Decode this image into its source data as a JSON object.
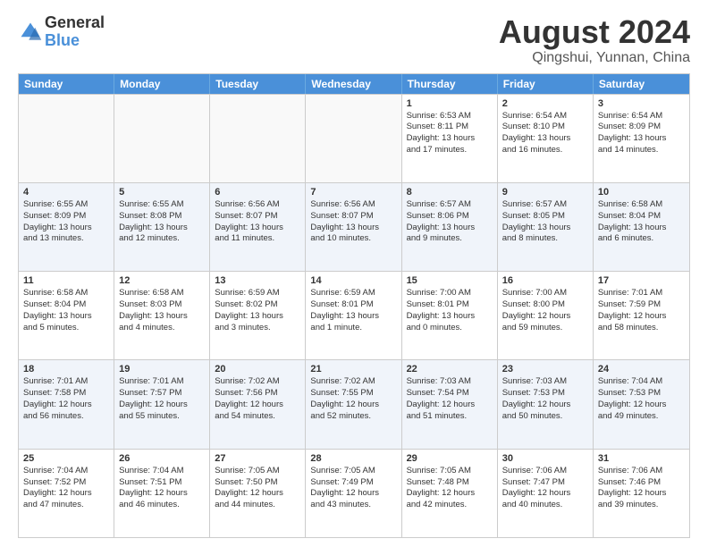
{
  "logo": {
    "general": "General",
    "blue": "Blue"
  },
  "title": "August 2024",
  "location": "Qingshui, Yunnan, China",
  "header_days": [
    "Sunday",
    "Monday",
    "Tuesday",
    "Wednesday",
    "Thursday",
    "Friday",
    "Saturday"
  ],
  "rows": [
    [
      {
        "day": "",
        "lines": [],
        "empty": true
      },
      {
        "day": "",
        "lines": [],
        "empty": true
      },
      {
        "day": "",
        "lines": [],
        "empty": true
      },
      {
        "day": "",
        "lines": [],
        "empty": true
      },
      {
        "day": "1",
        "lines": [
          "Sunrise: 6:53 AM",
          "Sunset: 8:11 PM",
          "Daylight: 13 hours",
          "and 17 minutes."
        ]
      },
      {
        "day": "2",
        "lines": [
          "Sunrise: 6:54 AM",
          "Sunset: 8:10 PM",
          "Daylight: 13 hours",
          "and 16 minutes."
        ]
      },
      {
        "day": "3",
        "lines": [
          "Sunrise: 6:54 AM",
          "Sunset: 8:09 PM",
          "Daylight: 13 hours",
          "and 14 minutes."
        ]
      }
    ],
    [
      {
        "day": "4",
        "lines": [
          "Sunrise: 6:55 AM",
          "Sunset: 8:09 PM",
          "Daylight: 13 hours",
          "and 13 minutes."
        ]
      },
      {
        "day": "5",
        "lines": [
          "Sunrise: 6:55 AM",
          "Sunset: 8:08 PM",
          "Daylight: 13 hours",
          "and 12 minutes."
        ]
      },
      {
        "day": "6",
        "lines": [
          "Sunrise: 6:56 AM",
          "Sunset: 8:07 PM",
          "Daylight: 13 hours",
          "and 11 minutes."
        ]
      },
      {
        "day": "7",
        "lines": [
          "Sunrise: 6:56 AM",
          "Sunset: 8:07 PM",
          "Daylight: 13 hours",
          "and 10 minutes."
        ]
      },
      {
        "day": "8",
        "lines": [
          "Sunrise: 6:57 AM",
          "Sunset: 8:06 PM",
          "Daylight: 13 hours",
          "and 9 minutes."
        ]
      },
      {
        "day": "9",
        "lines": [
          "Sunrise: 6:57 AM",
          "Sunset: 8:05 PM",
          "Daylight: 13 hours",
          "and 8 minutes."
        ]
      },
      {
        "day": "10",
        "lines": [
          "Sunrise: 6:58 AM",
          "Sunset: 8:04 PM",
          "Daylight: 13 hours",
          "and 6 minutes."
        ]
      }
    ],
    [
      {
        "day": "11",
        "lines": [
          "Sunrise: 6:58 AM",
          "Sunset: 8:04 PM",
          "Daylight: 13 hours",
          "and 5 minutes."
        ]
      },
      {
        "day": "12",
        "lines": [
          "Sunrise: 6:58 AM",
          "Sunset: 8:03 PM",
          "Daylight: 13 hours",
          "and 4 minutes."
        ]
      },
      {
        "day": "13",
        "lines": [
          "Sunrise: 6:59 AM",
          "Sunset: 8:02 PM",
          "Daylight: 13 hours",
          "and 3 minutes."
        ]
      },
      {
        "day": "14",
        "lines": [
          "Sunrise: 6:59 AM",
          "Sunset: 8:01 PM",
          "Daylight: 13 hours",
          "and 1 minute."
        ]
      },
      {
        "day": "15",
        "lines": [
          "Sunrise: 7:00 AM",
          "Sunset: 8:01 PM",
          "Daylight: 13 hours",
          "and 0 minutes."
        ]
      },
      {
        "day": "16",
        "lines": [
          "Sunrise: 7:00 AM",
          "Sunset: 8:00 PM",
          "Daylight: 12 hours",
          "and 59 minutes."
        ]
      },
      {
        "day": "17",
        "lines": [
          "Sunrise: 7:01 AM",
          "Sunset: 7:59 PM",
          "Daylight: 12 hours",
          "and 58 minutes."
        ]
      }
    ],
    [
      {
        "day": "18",
        "lines": [
          "Sunrise: 7:01 AM",
          "Sunset: 7:58 PM",
          "Daylight: 12 hours",
          "and 56 minutes."
        ]
      },
      {
        "day": "19",
        "lines": [
          "Sunrise: 7:01 AM",
          "Sunset: 7:57 PM",
          "Daylight: 12 hours",
          "and 55 minutes."
        ]
      },
      {
        "day": "20",
        "lines": [
          "Sunrise: 7:02 AM",
          "Sunset: 7:56 PM",
          "Daylight: 12 hours",
          "and 54 minutes."
        ]
      },
      {
        "day": "21",
        "lines": [
          "Sunrise: 7:02 AM",
          "Sunset: 7:55 PM",
          "Daylight: 12 hours",
          "and 52 minutes."
        ]
      },
      {
        "day": "22",
        "lines": [
          "Sunrise: 7:03 AM",
          "Sunset: 7:54 PM",
          "Daylight: 12 hours",
          "and 51 minutes."
        ]
      },
      {
        "day": "23",
        "lines": [
          "Sunrise: 7:03 AM",
          "Sunset: 7:53 PM",
          "Daylight: 12 hours",
          "and 50 minutes."
        ]
      },
      {
        "day": "24",
        "lines": [
          "Sunrise: 7:04 AM",
          "Sunset: 7:53 PM",
          "Daylight: 12 hours",
          "and 49 minutes."
        ]
      }
    ],
    [
      {
        "day": "25",
        "lines": [
          "Sunrise: 7:04 AM",
          "Sunset: 7:52 PM",
          "Daylight: 12 hours",
          "and 47 minutes."
        ]
      },
      {
        "day": "26",
        "lines": [
          "Sunrise: 7:04 AM",
          "Sunset: 7:51 PM",
          "Daylight: 12 hours",
          "and 46 minutes."
        ]
      },
      {
        "day": "27",
        "lines": [
          "Sunrise: 7:05 AM",
          "Sunset: 7:50 PM",
          "Daylight: 12 hours",
          "and 44 minutes."
        ]
      },
      {
        "day": "28",
        "lines": [
          "Sunrise: 7:05 AM",
          "Sunset: 7:49 PM",
          "Daylight: 12 hours",
          "and 43 minutes."
        ]
      },
      {
        "day": "29",
        "lines": [
          "Sunrise: 7:05 AM",
          "Sunset: 7:48 PM",
          "Daylight: 12 hours",
          "and 42 minutes."
        ]
      },
      {
        "day": "30",
        "lines": [
          "Sunrise: 7:06 AM",
          "Sunset: 7:47 PM",
          "Daylight: 12 hours",
          "and 40 minutes."
        ]
      },
      {
        "day": "31",
        "lines": [
          "Sunrise: 7:06 AM",
          "Sunset: 7:46 PM",
          "Daylight: 12 hours",
          "and 39 minutes."
        ]
      }
    ]
  ]
}
